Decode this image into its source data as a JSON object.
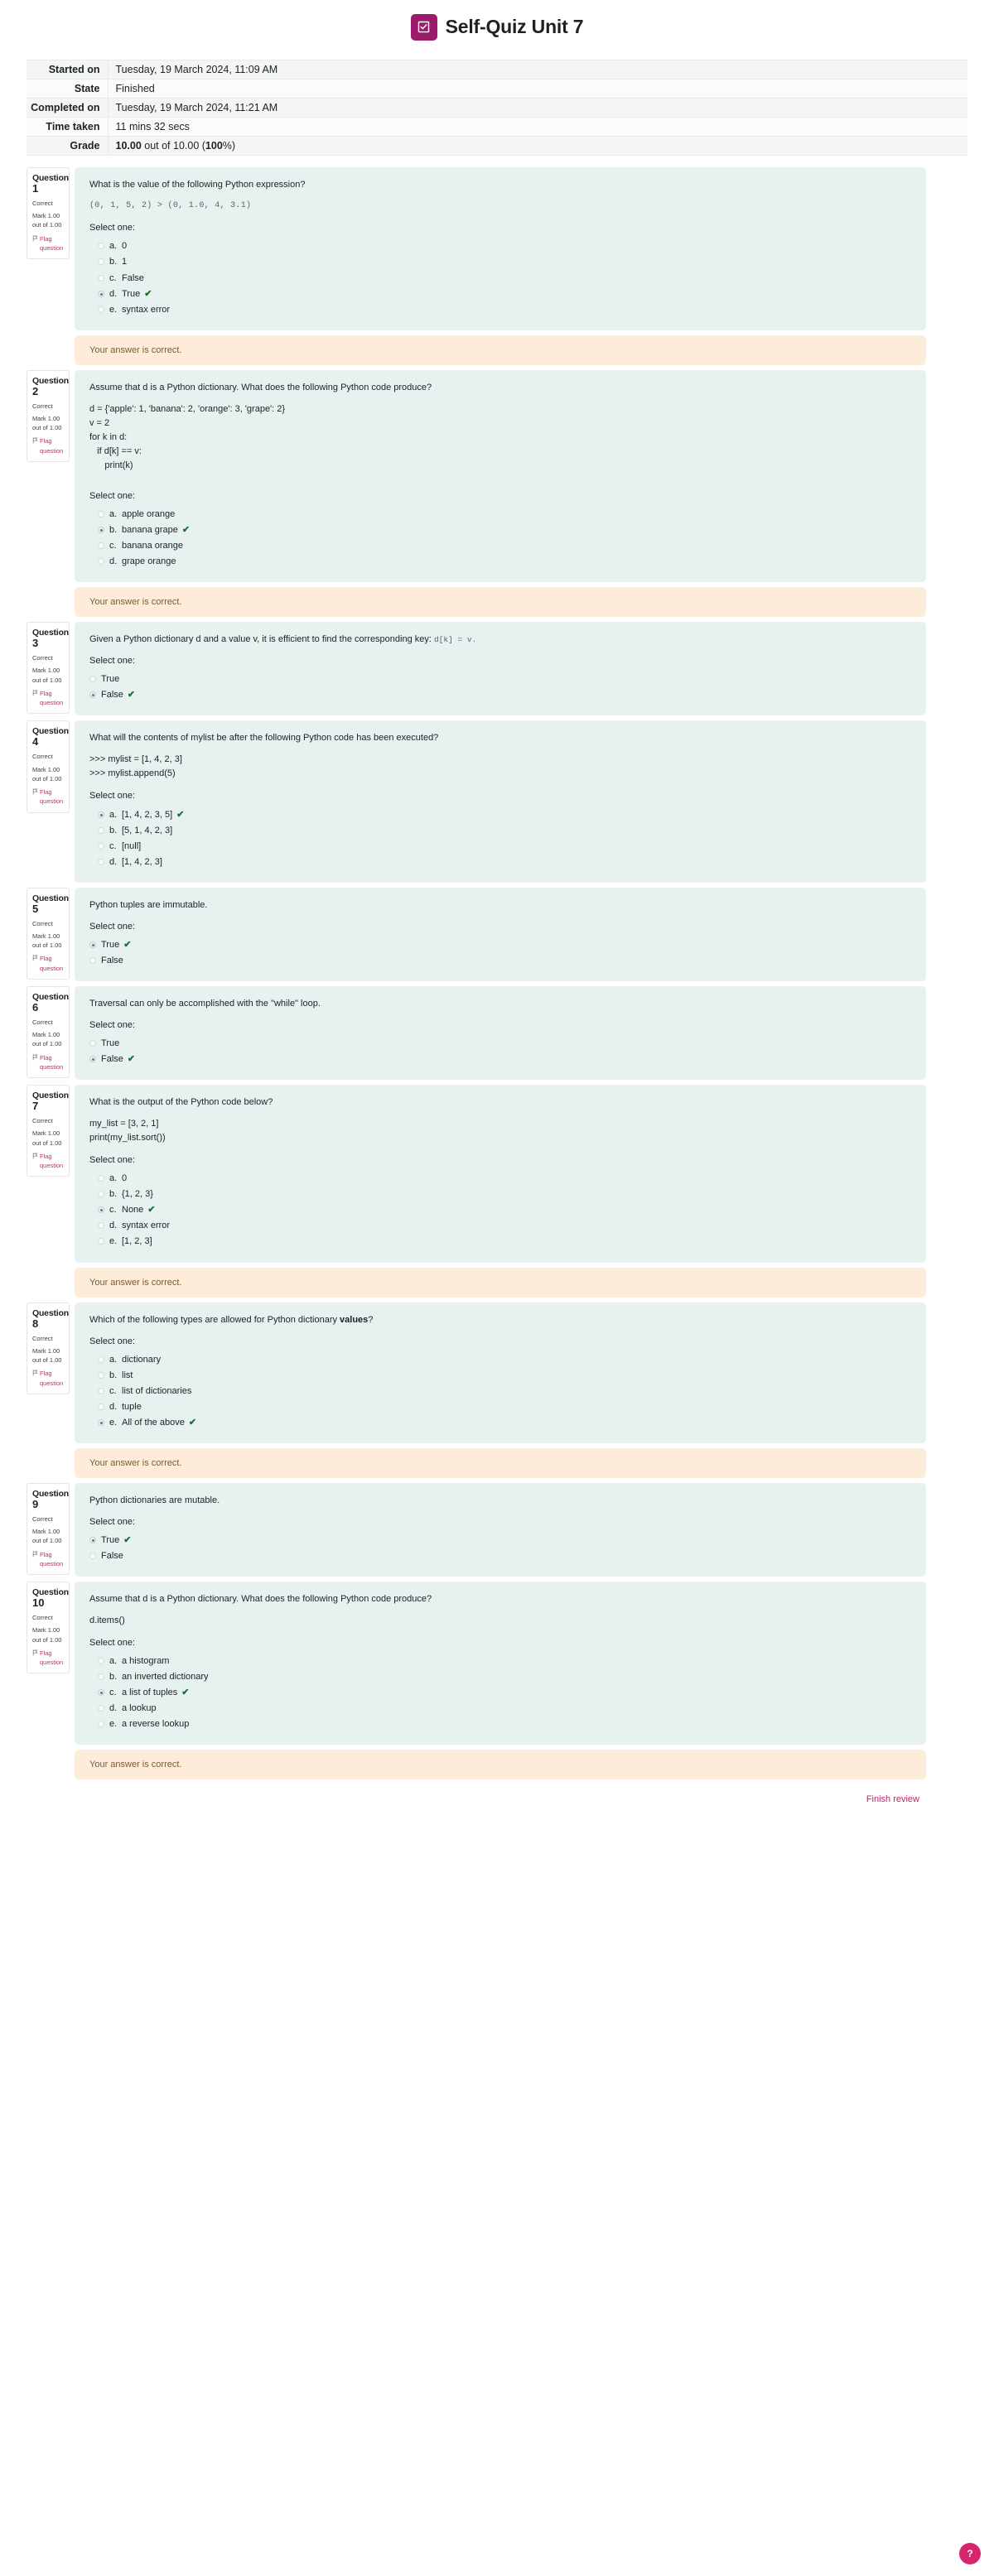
{
  "header": {
    "title": "Self-Quiz Unit 7",
    "icon": "quiz-checkbox-icon"
  },
  "summary": {
    "rows": [
      {
        "label": "Started on",
        "value": "Tuesday, 19 March 2024, 11:09 AM"
      },
      {
        "label": "State",
        "value": "Finished"
      },
      {
        "label": "Completed on",
        "value": "Tuesday, 19 March 2024, 11:21 AM"
      },
      {
        "label": "Time taken",
        "value": "11 mins 32 secs"
      }
    ],
    "grade": {
      "label": "Grade",
      "score": "10.00",
      "middle": " out of 10.00 (",
      "percent": "100",
      "suffix": "%)"
    }
  },
  "labels": {
    "question_word": "Question",
    "select_one": "Select one:",
    "flag": "Flag question",
    "feedback_correct": "Your answer is correct.",
    "state_correct": "Correct",
    "mark": "Mark 1.00 out of 1.00"
  },
  "colors": {
    "brand": "#9c1c6b",
    "accent": "#d6246e",
    "question_bg": "#e6f1f0",
    "feedback_bg": "#fcecd9",
    "tick": "#137333"
  },
  "questions": [
    {
      "number": "1",
      "state": "Correct",
      "mark": "Mark 1.00 out of 1.00",
      "flag": "Flag question",
      "text": "What is the value of the following Python expression?",
      "code": "(0, 1, 5, 2) > (0, 1.0, 4, 3.1)",
      "style": "lettered",
      "options": [
        {
          "letter": "a.",
          "text": "0",
          "selected": false,
          "correct": false
        },
        {
          "letter": "b.",
          "text": "1",
          "selected": false,
          "correct": false
        },
        {
          "letter": "c.",
          "text": "False",
          "selected": false,
          "correct": false
        },
        {
          "letter": "d.",
          "text": "True",
          "selected": true,
          "correct": true
        },
        {
          "letter": "e.",
          "text": "syntax error",
          "selected": false,
          "correct": false
        }
      ],
      "feedback": "Your answer is correct."
    },
    {
      "number": "2",
      "state": "Correct",
      "mark": "Mark 1.00 out of 1.00",
      "flag": "Flag question",
      "text": "Assume that d is a Python dictionary. What does the following Python code produce?",
      "pre": "d = {'apple': 1, 'banana': 2, 'orange': 3, 'grape': 2}\nv = 2\nfor k in d:\n   if d[k] == v:\n      print(k)",
      "style": "lettered",
      "options": [
        {
          "letter": "a.",
          "text": "apple orange",
          "selected": false,
          "correct": false
        },
        {
          "letter": "b.",
          "text": "banana grape",
          "selected": true,
          "correct": true
        },
        {
          "letter": "c.",
          "text": "banana orange",
          "selected": false,
          "correct": false
        },
        {
          "letter": "d.",
          "text": "grape orange",
          "selected": false,
          "correct": false
        }
      ],
      "feedback": "Your answer is correct."
    },
    {
      "number": "3",
      "state": "Correct",
      "mark": "Mark 1.00 out of 1.00",
      "flag": "Flag question",
      "text": "Given a Python dictionary d and a value v, it is efficient to find the corresponding key:",
      "inline_code": "d[k] = v.",
      "style": "plain",
      "options": [
        {
          "letter": "",
          "text": "True",
          "selected": false,
          "correct": false
        },
        {
          "letter": "",
          "text": "False",
          "selected": true,
          "correct": true
        }
      ],
      "feedback": ""
    },
    {
      "number": "4",
      "state": "Correct",
      "mark": "Mark 1.00 out of 1.00",
      "flag": "Flag question",
      "text": "What will the contents of mylist be after the following Python code has been executed?",
      "pre": ">>> mylist = [1, 4, 2, 3]\n>>> mylist.append(5)",
      "style": "lettered",
      "options": [
        {
          "letter": "a.",
          "text": "[1, 4, 2, 3, 5]",
          "selected": true,
          "correct": true
        },
        {
          "letter": "b.",
          "text": "[5, 1, 4, 2, 3]",
          "selected": false,
          "correct": false
        },
        {
          "letter": "c.",
          "text": "[null]",
          "selected": false,
          "correct": false
        },
        {
          "letter": "d.",
          "text": "[1, 4, 2, 3]",
          "selected": false,
          "correct": false
        }
      ],
      "feedback": ""
    },
    {
      "number": "5",
      "state": "Correct",
      "mark": "Mark 1.00 out of 1.00",
      "flag": "Flag question",
      "text": "Python tuples are immutable.",
      "style": "plain",
      "options": [
        {
          "letter": "",
          "text": "True",
          "selected": true,
          "correct": true
        },
        {
          "letter": "",
          "text": "False",
          "selected": false,
          "correct": false
        }
      ],
      "feedback": ""
    },
    {
      "number": "6",
      "state": "Correct",
      "mark": "Mark 1.00 out of 1.00",
      "flag": "Flag question",
      "text": "Traversal can only be accomplished with the \"while\" loop.",
      "style": "plain",
      "options": [
        {
          "letter": "",
          "text": "True",
          "selected": false,
          "correct": false
        },
        {
          "letter": "",
          "text": "False",
          "selected": true,
          "correct": true
        }
      ],
      "feedback": ""
    },
    {
      "number": "7",
      "state": "Correct",
      "mark": "Mark 1.00 out of 1.00",
      "flag": "Flag question",
      "text": "What is the output of the Python code below?",
      "pre": "my_list = [3, 2, 1]\nprint(my_list.sort())",
      "style": "lettered",
      "options": [
        {
          "letter": "a.",
          "text": "0",
          "selected": false,
          "correct": false
        },
        {
          "letter": "b.",
          "text": "{1, 2, 3}",
          "selected": false,
          "correct": false
        },
        {
          "letter": "c.",
          "text": "None",
          "selected": true,
          "correct": true
        },
        {
          "letter": "d.",
          "text": "syntax error",
          "selected": false,
          "correct": false
        },
        {
          "letter": "e.",
          "text": "[1, 2, 3]",
          "selected": false,
          "correct": false
        }
      ],
      "feedback": "Your answer is correct."
    },
    {
      "number": "8",
      "state": "Correct",
      "mark": "Mark 1.00 out of 1.00",
      "flag": "Flag question",
      "text_pre": "Which of the following types are allowed for Python dictionary ",
      "text_bold": "values",
      "text_post": "?",
      "style": "lettered",
      "options": [
        {
          "letter": "a.",
          "text": "dictionary",
          "selected": false,
          "correct": false
        },
        {
          "letter": "b.",
          "text": "list",
          "selected": false,
          "correct": false
        },
        {
          "letter": "c.",
          "text": "list of dictionaries",
          "selected": false,
          "correct": false
        },
        {
          "letter": "d.",
          "text": "tuple",
          "selected": false,
          "correct": false
        },
        {
          "letter": "e.",
          "text": "All of the above",
          "selected": true,
          "correct": true
        }
      ],
      "feedback": "Your answer is correct."
    },
    {
      "number": "9",
      "state": "Correct",
      "mark": "Mark 1.00 out of 1.00",
      "flag": "Flag question",
      "text": "Python dictionaries are mutable.",
      "style": "plain",
      "options": [
        {
          "letter": "",
          "text": "True",
          "selected": true,
          "correct": true
        },
        {
          "letter": "",
          "text": "False",
          "selected": false,
          "correct": false
        }
      ],
      "feedback": ""
    },
    {
      "number": "10",
      "state": "Correct",
      "mark": "Mark 1.00 out of 1.00",
      "flag": "Flag question",
      "text": "Assume that d is a Python dictionary. What does the following Python code produce?",
      "pre": "d.items()",
      "style": "lettered",
      "options": [
        {
          "letter": "a.",
          "text": "a histogram",
          "selected": false,
          "correct": false
        },
        {
          "letter": "b.",
          "text": "an inverted dictionary",
          "selected": false,
          "correct": false
        },
        {
          "letter": "c.",
          "text": "a list of tuples",
          "selected": true,
          "correct": true
        },
        {
          "letter": "d.",
          "text": "a lookup",
          "selected": false,
          "correct": false
        },
        {
          "letter": "e.",
          "text": "a reverse lookup",
          "selected": false,
          "correct": false
        }
      ],
      "feedback": "Your answer is correct."
    }
  ],
  "footer": {
    "finish_review": "Finish review",
    "help_label": "?"
  }
}
